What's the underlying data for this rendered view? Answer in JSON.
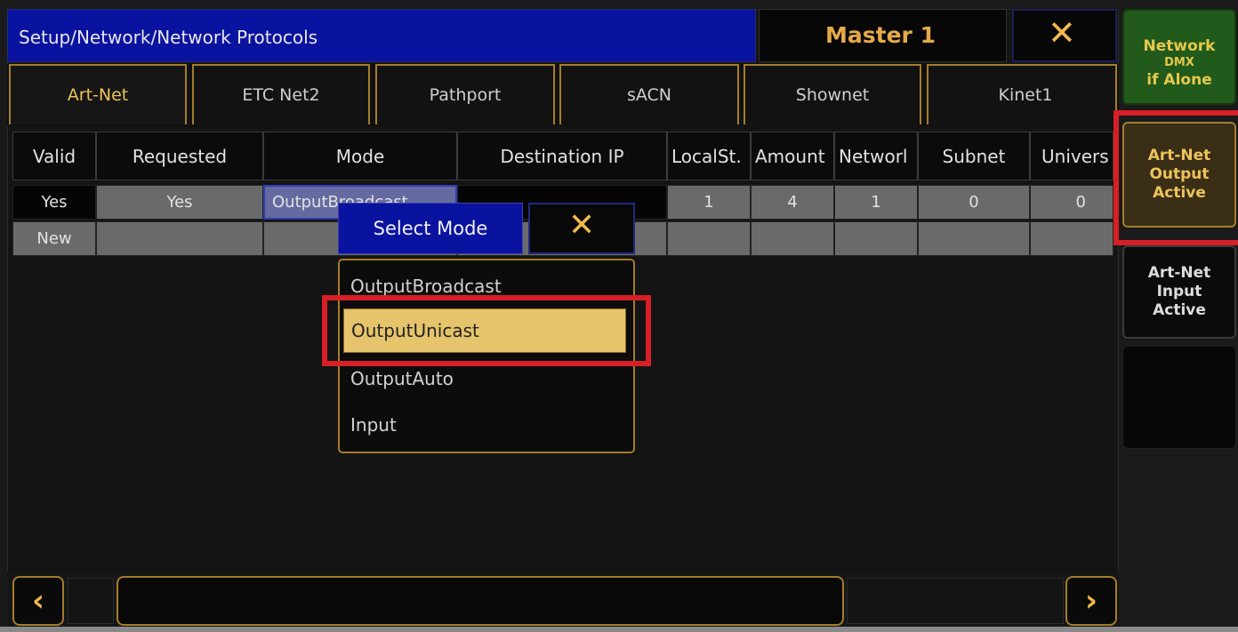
{
  "title": "Setup/Network/Network Protocols",
  "master": "Master 1",
  "close_glyph": "✕",
  "tabs": [
    "Art-Net",
    "ETC Net2",
    "Pathport",
    "sACN",
    "Shownet",
    "Kinet1"
  ],
  "active_tab": "Art-Net",
  "columns": [
    "Valid",
    "Requested",
    "Mode",
    "Destination IP",
    "LocalSt.",
    "Amount",
    "Networl",
    "Subnet",
    "Univers"
  ],
  "rows": [
    {
      "valid": "Yes",
      "requested": "Yes",
      "mode": "OutputBroadcast",
      "destination_ip": "",
      "local_start": "1",
      "amount": "4",
      "network": "1",
      "subnet": "0",
      "universe": "0"
    },
    {
      "valid": "New",
      "requested": "",
      "mode": "",
      "destination_ip": "",
      "local_start": "",
      "amount": "",
      "network": "",
      "subnet": "",
      "universe": ""
    }
  ],
  "popup": {
    "title": "Select Mode",
    "close_glyph": "✕",
    "options": [
      "OutputBroadcast",
      "OutputUnicast",
      "OutputAuto",
      "Input"
    ],
    "selected": "OutputUnicast"
  },
  "right_buttons": {
    "network_dmx": {
      "line1": "Network",
      "line2": "DMX",
      "line3": "if Alone"
    },
    "artnet_output": {
      "line1": "Art-Net",
      "line2": "Output",
      "line3": "Active"
    },
    "artnet_input": {
      "line1": "Art-Net",
      "line2": "Input",
      "line3": "Active"
    }
  },
  "scroll": {
    "left_glyph": "‹",
    "right_glyph": "›"
  },
  "colors": {
    "accent": "#e6a94a",
    "titlebar": "#0a13a0",
    "selected_option": "#e6c46b",
    "highlight": "#d61f26",
    "network_dmx_bg": "#215a1a"
  }
}
